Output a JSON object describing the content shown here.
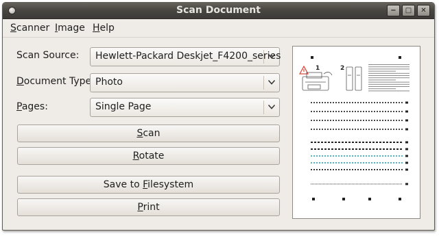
{
  "window": {
    "title": "Scan Document",
    "controls": {
      "minimize": "−",
      "maximize": "□",
      "close": "✕"
    }
  },
  "menubar": {
    "items": [
      {
        "name": "menu-scanner",
        "label": "Scanner",
        "mnemonic": "S",
        "rest": "canner"
      },
      {
        "name": "menu-image",
        "label": "Image",
        "mnemonic": "I",
        "rest": "mage"
      },
      {
        "name": "menu-help",
        "label": "Help",
        "mnemonic": "H",
        "rest": "elp"
      }
    ]
  },
  "form": {
    "scan_source": {
      "label": "Scan Source:",
      "value": "Hewlett-Packard Deskjet_F4200_series"
    },
    "document_type": {
      "label": "Document Type:",
      "label_mnemonic": "D",
      "label_rest": "ocument Type:",
      "value": "Photo"
    },
    "pages": {
      "label": "Pages:",
      "label_mnemonic": "P",
      "label_rest": "ages:",
      "value": "Single Page"
    }
  },
  "buttons": {
    "scan": {
      "label": "Scan",
      "mnemonic": "S",
      "rest": "can"
    },
    "rotate": {
      "label": "Rotate",
      "mnemonic": "R",
      "rest": "otate"
    },
    "save": {
      "label": "Save to Filesystem",
      "pre": "Save to ",
      "mnemonic": "F",
      "rest": "ilesystem"
    },
    "print": {
      "label": "Print",
      "mnemonic": "P",
      "rest": "rint"
    }
  },
  "preview": {
    "step_numbers": [
      "1",
      "2"
    ],
    "warning_icon": "warning-triangle-icon"
  },
  "colors": {
    "window_bg": "#efebe7",
    "titlebar": "#4a4742",
    "preview_accent": "#4fb3c8",
    "warning": "#d94a3c"
  }
}
